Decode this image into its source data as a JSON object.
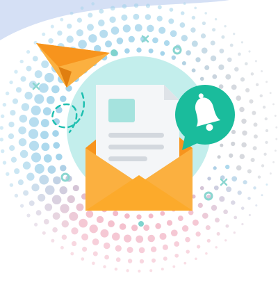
{
  "illustration": {
    "subject": "email-notification",
    "icons": [
      "paper-plane-icon",
      "document-icon",
      "envelope-icon",
      "bell-icon"
    ],
    "colors": {
      "background": "#ffffff",
      "corner_wave": "#d5e0f5",
      "halo": "#b9ebe9",
      "plane_light": "#fbb040",
      "plane_dark": "#f7941d",
      "envelope_light": "#fbb040",
      "envelope_dark": "#f7941d",
      "paper": "#f4f6f8",
      "paper_fold": "#dfe3e8",
      "doc_square": "#a5e3de",
      "doc_lines": "#d3d8de",
      "bubble": "#1abc9c",
      "bell": "#ffffff",
      "dash": "#1fbfb0",
      "dots_cool": "#9fd2ea",
      "dots_pink": "#f2b6c6",
      "dots_grey": "#c9ccd3"
    }
  }
}
